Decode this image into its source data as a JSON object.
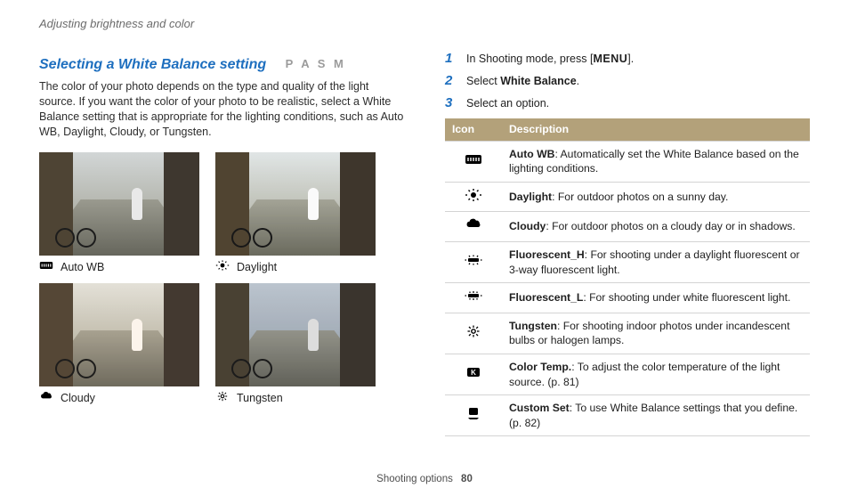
{
  "running_head": "Adjusting brightness and color",
  "section_title": "Selecting a White Balance setting",
  "mode_badge": "P A S M",
  "intro": "The color of your photo depends on the type and quality of the light source. If you want the color of your photo to be realistic, select a White Balance setting that is appropriate for the lighting conditions, such as Auto WB, Daylight, Cloudy, or Tungsten.",
  "thumbs": {
    "auto": "Auto WB",
    "daylight": "Daylight",
    "cloudy": "Cloudy",
    "tungsten": "Tungsten"
  },
  "steps": {
    "s1_pre": "In Shooting mode, press [",
    "s1_menu": "MENU",
    "s1_post": "].",
    "s2_pre": "Select ",
    "s2_bold": "White Balance",
    "s2_post": ".",
    "s3": "Select an option."
  },
  "table": {
    "head_icon": "Icon",
    "head_desc": "Description",
    "rows": [
      {
        "icon": "awb",
        "bold": "Auto WB",
        "text": ": Automatically set the White Balance based on the lighting conditions."
      },
      {
        "icon": "daylight",
        "bold": "Daylight",
        "text": ": For outdoor photos on a sunny day."
      },
      {
        "icon": "cloudy",
        "bold": "Cloudy",
        "text": ": For outdoor photos on a cloudy day or in shadows."
      },
      {
        "icon": "fluo_h",
        "bold": "Fluorescent_H",
        "text": ": For shooting under a daylight fluorescent or 3-way fluorescent light."
      },
      {
        "icon": "fluo_l",
        "bold": "Fluorescent_L",
        "text": ": For shooting under white fluorescent light."
      },
      {
        "icon": "tungsten",
        "bold": "Tungsten",
        "text": ": For shooting indoor photos under incandescent bulbs or halogen lamps."
      },
      {
        "icon": "colortemp",
        "bold": "Color Temp.",
        "text": ": To adjust the color temperature of the light source. (p. 81)"
      },
      {
        "icon": "custom",
        "bold": "Custom Set",
        "text": ": To use White Balance settings that you define. (p. 82)"
      }
    ]
  },
  "footer_label": "Shooting options",
  "footer_page": "80"
}
